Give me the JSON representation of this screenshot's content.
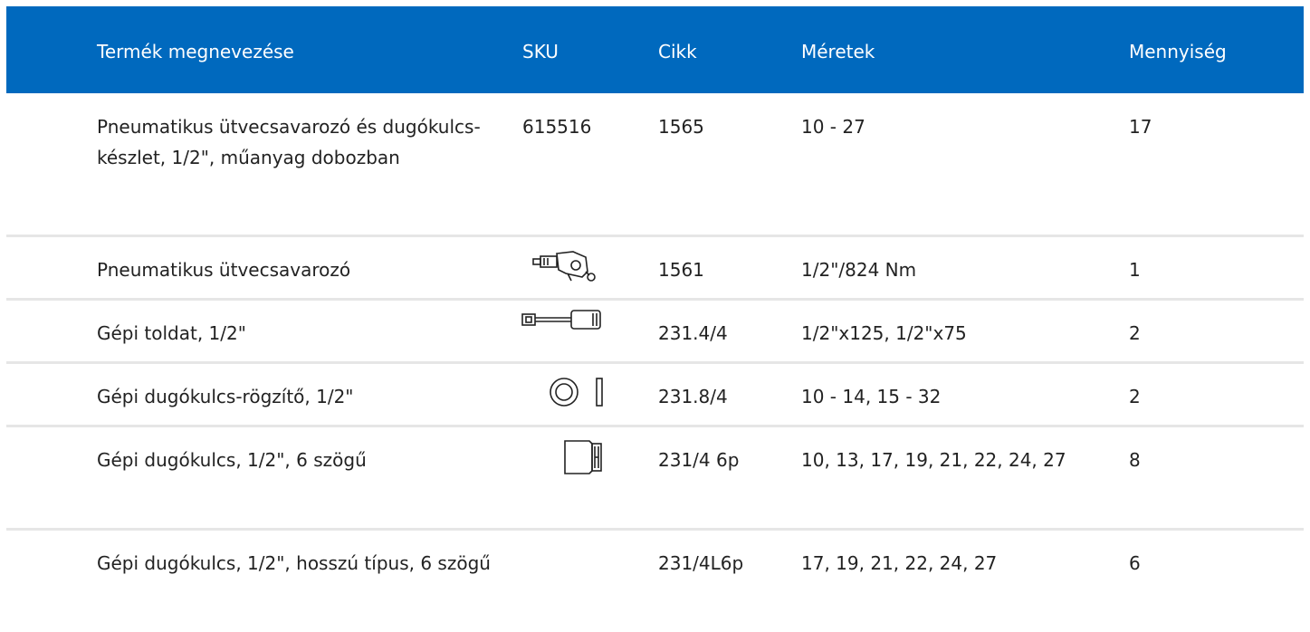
{
  "table": {
    "header_color": "#0069be",
    "columns": [
      "Termék megnevezése",
      "SKU",
      "Cikk",
      "Méretek",
      "Mennyiség"
    ],
    "rows": [
      {
        "name": "Pneumatikus ütvecsavarozó és dugókulcs-készlet, 1/2\", műanyag dobozban",
        "sku": "615516",
        "cikk": "1565",
        "size": "10 - 27",
        "qty": "17",
        "icon": ""
      },
      {
        "name": "Pneumatikus ütvecsavarozó",
        "sku": "",
        "cikk": "1561",
        "size": "1/2\"/824 Nm",
        "qty": "1",
        "icon": "impact-wrench-icon"
      },
      {
        "name": "Gépi toldat, 1/2\"",
        "sku": "",
        "cikk": "231.4/4",
        "size": "1/2\"x125, 1/2\"x75",
        "qty": "2",
        "icon": "extension-bar-icon"
      },
      {
        "name": "Gépi dugókulcs-rögzítő, 1/2\"",
        "sku": "",
        "cikk": "231.8/4",
        "size": "10 - 14, 15 - 32",
        "qty": "2",
        "icon": "retaining-ring-icon"
      },
      {
        "name": "Gépi dugókulcs, 1/2\", 6 szögű",
        "sku": "",
        "cikk": "231/4 6p",
        "size": "10, 13, 17, 19, 21, 22, 24, 27",
        "qty": "8",
        "icon": "socket-icon"
      },
      {
        "name": "Gépi dugókulcs, 1/2\", hosszú típus, 6 szögű",
        "sku": "",
        "cikk": "231/4L6p",
        "size": "17, 19, 21, 22, 24, 27",
        "qty": "6",
        "icon": ""
      }
    ]
  }
}
